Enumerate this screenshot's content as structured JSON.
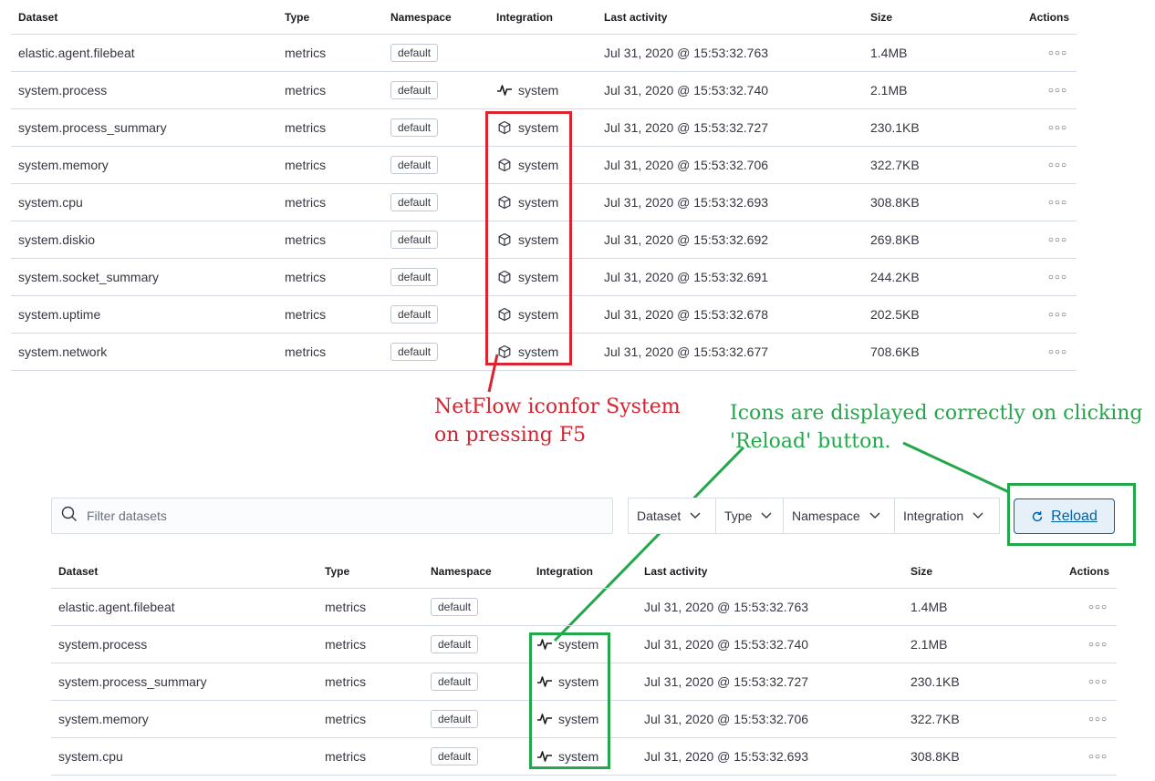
{
  "columns": {
    "dataset": "Dataset",
    "type": "Type",
    "namespace": "Namespace",
    "integration": "Integration",
    "last_activity": "Last activity",
    "size": "Size",
    "actions": "Actions"
  },
  "top_rows": [
    {
      "dataset": "elastic.agent.filebeat",
      "type": "metrics",
      "namespace": "default",
      "integration": "",
      "icon": "",
      "last_activity": "Jul 31, 2020 @ 15:53:32.763",
      "size": "1.4MB"
    },
    {
      "dataset": "system.process",
      "type": "metrics",
      "namespace": "default",
      "integration": "system",
      "icon": "pulse-icon",
      "last_activity": "Jul 31, 2020 @ 15:53:32.740",
      "size": "2.1MB"
    },
    {
      "dataset": "system.process_summary",
      "type": "metrics",
      "namespace": "default",
      "integration": "system",
      "icon": "package-icon",
      "last_activity": "Jul 31, 2020 @ 15:53:32.727",
      "size": "230.1KB"
    },
    {
      "dataset": "system.memory",
      "type": "metrics",
      "namespace": "default",
      "integration": "system",
      "icon": "package-icon",
      "last_activity": "Jul 31, 2020 @ 15:53:32.706",
      "size": "322.7KB"
    },
    {
      "dataset": "system.cpu",
      "type": "metrics",
      "namespace": "default",
      "integration": "system",
      "icon": "package-icon",
      "last_activity": "Jul 31, 2020 @ 15:53:32.693",
      "size": "308.8KB"
    },
    {
      "dataset": "system.diskio",
      "type": "metrics",
      "namespace": "default",
      "integration": "system",
      "icon": "package-icon",
      "last_activity": "Jul 31, 2020 @ 15:53:32.692",
      "size": "269.8KB"
    },
    {
      "dataset": "system.socket_summary",
      "type": "metrics",
      "namespace": "default",
      "integration": "system",
      "icon": "package-icon",
      "last_activity": "Jul 31, 2020 @ 15:53:32.691",
      "size": "244.2KB"
    },
    {
      "dataset": "system.uptime",
      "type": "metrics",
      "namespace": "default",
      "integration": "system",
      "icon": "package-icon",
      "last_activity": "Jul 31, 2020 @ 15:53:32.678",
      "size": "202.5KB"
    },
    {
      "dataset": "system.network",
      "type": "metrics",
      "namespace": "default",
      "integration": "system",
      "icon": "package-icon",
      "last_activity": "Jul 31, 2020 @ 15:53:32.677",
      "size": "708.6KB"
    }
  ],
  "bottom_rows": [
    {
      "dataset": "elastic.agent.filebeat",
      "type": "metrics",
      "namespace": "default",
      "integration": "",
      "icon": "",
      "last_activity": "Jul 31, 2020 @ 15:53:32.763",
      "size": "1.4MB"
    },
    {
      "dataset": "system.process",
      "type": "metrics",
      "namespace": "default",
      "integration": "system",
      "icon": "pulse-icon",
      "last_activity": "Jul 31, 2020 @ 15:53:32.740",
      "size": "2.1MB"
    },
    {
      "dataset": "system.process_summary",
      "type": "metrics",
      "namespace": "default",
      "integration": "system",
      "icon": "pulse-icon",
      "last_activity": "Jul 31, 2020 @ 15:53:32.727",
      "size": "230.1KB"
    },
    {
      "dataset": "system.memory",
      "type": "metrics",
      "namespace": "default",
      "integration": "system",
      "icon": "pulse-icon",
      "last_activity": "Jul 31, 2020 @ 15:53:32.706",
      "size": "322.7KB"
    },
    {
      "dataset": "system.cpu",
      "type": "metrics",
      "namespace": "default",
      "integration": "system",
      "icon": "pulse-icon",
      "last_activity": "Jul 31, 2020 @ 15:53:32.693",
      "size": "308.8KB"
    }
  ],
  "search": {
    "placeholder": "Filter datasets"
  },
  "filters": [
    "Dataset",
    "Type",
    "Namespace",
    "Integration"
  ],
  "reload_label": "Reload",
  "annotations": {
    "red_line1": "NetFlow iconfor System",
    "red_line2": "on pressing F5",
    "green_line1": "Icons are displayed correctly on clicking",
    "green_line2": "'Reload' button."
  },
  "colors": {
    "annotation_red": "#d52430",
    "annotation_green": "#22a84a",
    "link_blue": "#0061a6"
  }
}
